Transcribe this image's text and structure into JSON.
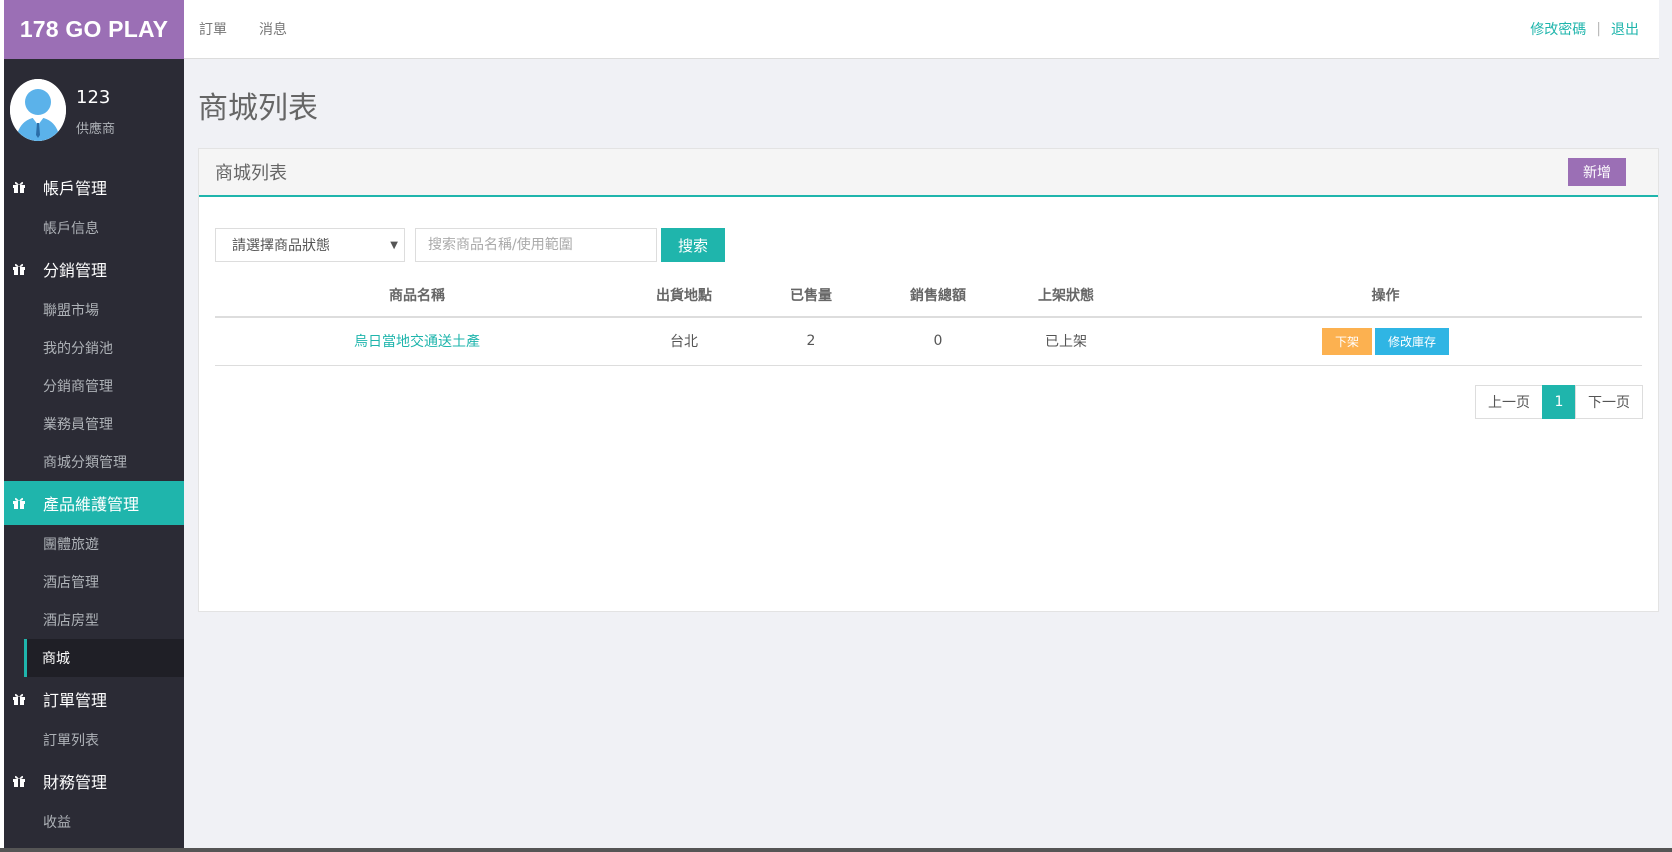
{
  "brand": {
    "title": "178 GO PLAY"
  },
  "topnav": {
    "items": [
      "訂單",
      "消息"
    ]
  },
  "topright": {
    "change_password": "修改密碼",
    "separator": "|",
    "logout": "退出"
  },
  "profile": {
    "name": "123",
    "role": "供應商"
  },
  "sidebar": {
    "groups": [
      {
        "label": "帳戶管理",
        "items": [
          "帳戶信息"
        ]
      },
      {
        "label": "分銷管理",
        "items": [
          "聯盟市場",
          "我的分銷池",
          "分銷商管理",
          "業務員管理",
          "商城分類管理"
        ]
      },
      {
        "label": "產品維護管理",
        "active": true,
        "items": [
          "團體旅遊",
          "酒店管理",
          "酒店房型",
          "商城"
        ],
        "active_item": "商城"
      },
      {
        "label": "訂單管理",
        "items": [
          "訂單列表"
        ]
      },
      {
        "label": "財務管理",
        "items": [
          "收益"
        ]
      }
    ]
  },
  "page": {
    "title": "商城列表"
  },
  "panel": {
    "title": "商城列表",
    "add_button": "新增",
    "status_select": "請選擇商品狀態",
    "search_placeholder": "搜索商品名稱/使用範圍",
    "search_button": "搜索",
    "columns": [
      "商品名稱",
      "出貨地點",
      "已售量",
      "銷售總額",
      "上架狀態",
      "操作"
    ],
    "rows": [
      {
        "name": "烏日當地交通送土產",
        "location": "台北",
        "sold": "2",
        "total": "0",
        "status": "已上架",
        "action_off": "下架",
        "action_stock": "修改庫存"
      }
    ],
    "pager": {
      "prev": "上一页",
      "current": "1",
      "next": "下一页"
    }
  },
  "colors": {
    "accent": "#1fb5ac",
    "brand": "#9b6fb5",
    "sidebar": "#2b2b35",
    "warning": "#fcb150",
    "info": "#2fb5e4"
  }
}
